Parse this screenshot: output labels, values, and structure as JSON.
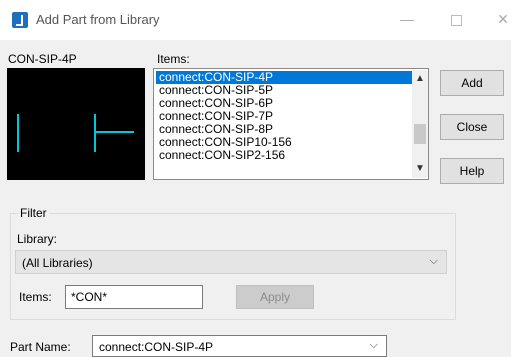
{
  "window": {
    "title": "Add Part from Library",
    "min_glyph": "—",
    "close_glyph": "✕",
    "icon": "library-app-icon"
  },
  "preview": {
    "part_label": "CON-SIP-4P",
    "line_color": "#00c8d8",
    "background": "#000000"
  },
  "items": {
    "label": "Items:",
    "list": [
      "connect:CON-SIP-4P",
      "connect:CON-SIP-5P",
      "connect:CON-SIP-6P",
      "connect:CON-SIP-7P",
      "connect:CON-SIP-8P",
      "connect:CON-SIP10-156",
      "connect:CON-SIP2-156"
    ],
    "selected_index": 0,
    "selection_color": "#0078d7",
    "scroll_up_icon": "▲",
    "scroll_down_icon": "▼"
  },
  "buttons": {
    "add": "Add",
    "close": "Close",
    "help": "Help"
  },
  "filter": {
    "group_label": "Filter",
    "library_label": "Library:",
    "library_value": "(All Libraries)",
    "items_label": "Items:",
    "items_value": "*CON*",
    "apply_label": "Apply"
  },
  "part_name": {
    "label": "Part Name:",
    "value": "connect:CON-SIP-4P"
  },
  "chevron_glyph": "⌵"
}
